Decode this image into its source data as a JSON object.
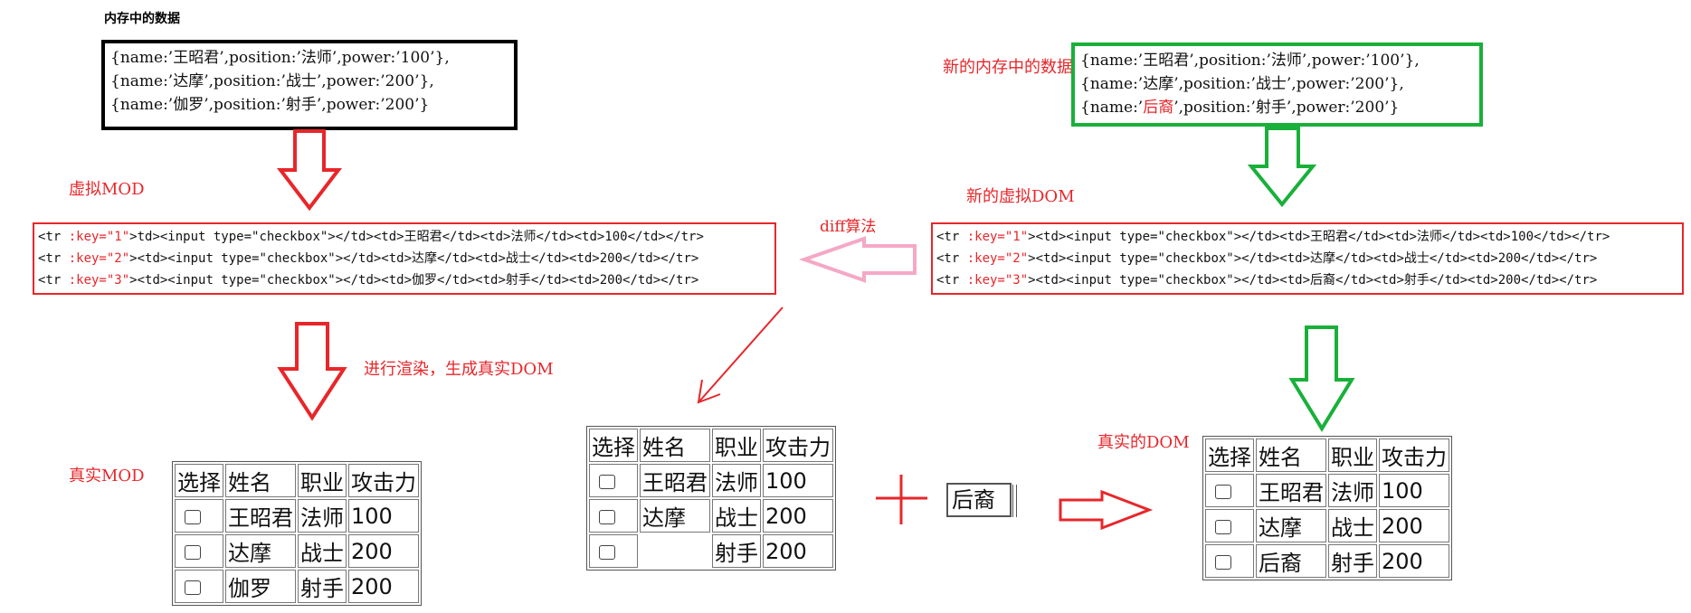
{
  "memory": {
    "title": "内存中的数据",
    "lines": [
      "{name:’王昭君’,position:’法师’,power:’100’},",
      "{name:’达摩’,position:’战士’,power:’200’},",
      "{name:’伽罗’,position:’射手’,power:’200’}"
    ]
  },
  "new_memory": {
    "title": "新的内存中的数据",
    "line1": "{name:’王昭君’,position:’法师’,power:’100’},",
    "line2": "{name:’达摩’,position:’战士’,power:’200’},",
    "line3_prefix": "{name:’",
    "line3_changed": "后裔",
    "line3_suffix": "’,position:’射手’,power:’200’}"
  },
  "vdom": {
    "title": "虚拟MOD",
    "rows": [
      {
        "pre": "<tr ",
        "key": ":key=\"1\"",
        "post": ">td><input type=\"checkbox\"></td><td>王昭君</td><td>法师</td><td>100</td></tr>"
      },
      {
        "pre": "<tr ",
        "key": ":key=\"2\"",
        "post": "><td><input type=\"checkbox\"></td><td>达摩</td><td>战士</td><td>200</td></tr>"
      },
      {
        "pre": "<tr ",
        "key": ":key=\"3\"",
        "post": "><td><input type=\"checkbox\"></td><td>伽罗</td><td>射手</td><td>200</td></tr>"
      }
    ]
  },
  "new_vdom": {
    "title": "新的虚拟DOM",
    "rows": [
      {
        "pre": "<tr ",
        "key": ":key=\"1\"",
        "post": "><td><input type=\"checkbox\"></td><td>王昭君</td><td>法师</td><td>100</td></tr>"
      },
      {
        "pre": "<tr ",
        "key": ":key=\"2\"",
        "post": "><td><input type=\"checkbox\"></td><td>达摩</td><td>战士</td><td>200</td></tr>"
      },
      {
        "pre": "<tr ",
        "key": ":key=\"3\"",
        "post": "><td><input type=\"checkbox\"></td><td>后裔</td><td>射手</td><td>200</td></tr>"
      }
    ]
  },
  "diff_label": "diff算法",
  "render_label": "进行渲染，生成真实DOM",
  "real_dom": {
    "title": "真实MOD",
    "headers": [
      "选择",
      "姓名",
      "职业",
      "攻击力"
    ],
    "rows": [
      [
        "王昭君",
        "法师",
        "100"
      ],
      [
        "达摩",
        "战士",
        "200"
      ],
      [
        "伽罗",
        "射手",
        "200"
      ]
    ]
  },
  "mid_table": {
    "headers": [
      "选择",
      "姓名",
      "职业",
      "攻击力"
    ],
    "rows": [
      [
        "王昭君",
        "法师",
        "100"
      ],
      [
        "达摩",
        "战士",
        "200"
      ],
      [
        "",
        "射手",
        "200"
      ]
    ]
  },
  "plus_input": {
    "value": "后裔"
  },
  "new_real_dom": {
    "title": "真实的DOM",
    "headers": [
      "选择",
      "姓名",
      "职业",
      "攻击力"
    ],
    "rows": [
      [
        "王昭君",
        "法师",
        "100"
      ],
      [
        "达摩",
        "战士",
        "200"
      ],
      [
        "后裔",
        "射手",
        "200"
      ]
    ]
  },
  "colors": {
    "red": "#e8262a",
    "green": "#19b03a",
    "pink": "#f5a8c6",
    "black": "#000000"
  }
}
